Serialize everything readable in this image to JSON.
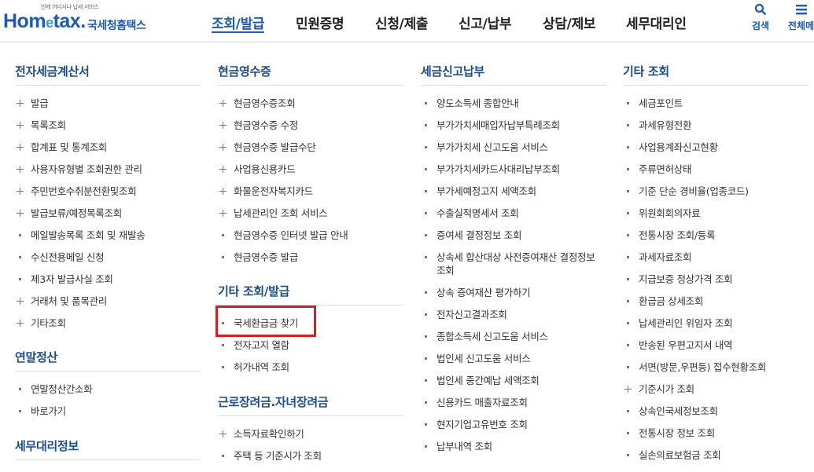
{
  "header": {
    "logo": {
      "tagline": "언제 어디서나 납세 서비스",
      "brand_a": "Hom",
      "brand_e": "e",
      "brand_b": "tax.",
      "agency": "국세청홈택스"
    },
    "nav": [
      "조회/발급",
      "민원증명",
      "신청/제출",
      "신고/납부",
      "상담/제보",
      "세무대리인"
    ],
    "active_nav": "조회/발급",
    "search_label": "검색",
    "menu_label": "전체메"
  },
  "colors": {
    "brand": "#1e5ab4",
    "section_title": "#1c4c8c",
    "highlight": "#d21f1f"
  },
  "columns": {
    "c1": {
      "s1": {
        "title": "전자세금계산서",
        "items": [
          {
            "label": "발급",
            "icon": "plus-icon"
          },
          {
            "label": "목록조회",
            "icon": "plus-icon"
          },
          {
            "label": "합계표 및 통계조회",
            "icon": "plus-icon"
          },
          {
            "label": "사용자유형별 조회권한 관리",
            "icon": "plus-icon"
          },
          {
            "label": "주민번호수취분전환및조회",
            "icon": "plus-icon"
          },
          {
            "label": "발급보류/예정목록조회",
            "icon": "plus-icon"
          },
          {
            "label": "메일발송목록 조회 및 재발송",
            "icon": "bullet-icon"
          },
          {
            "label": "수신전용메일 신청",
            "icon": "bullet-icon"
          },
          {
            "label": "제3자 발급사실 조회",
            "icon": "bullet-icon"
          },
          {
            "label": "거래처 및 품목관리",
            "icon": "plus-icon"
          },
          {
            "label": "기타조회",
            "icon": "plus-icon"
          }
        ]
      },
      "s2": {
        "title": "연말정산",
        "items": [
          {
            "label": "연말정산간소화",
            "icon": "bullet-icon"
          },
          {
            "label": "바로가기",
            "icon": "bullet-icon"
          }
        ]
      },
      "s3": {
        "title": "세무대리정보",
        "items": []
      }
    },
    "c2": {
      "s1": {
        "title": "현금영수증",
        "items": [
          {
            "label": "현금영수증조회",
            "icon": "plus-icon"
          },
          {
            "label": "현금영수증 수정",
            "icon": "plus-icon"
          },
          {
            "label": "현금영수증 발급수단",
            "icon": "plus-icon"
          },
          {
            "label": "사업용신용카드",
            "icon": "plus-icon"
          },
          {
            "label": "화물운전자복지카드",
            "icon": "plus-icon"
          },
          {
            "label": "납세관리인 조회 서비스",
            "icon": "plus-icon"
          },
          {
            "label": "현금영수증 인터넷 발급 안내",
            "icon": "bullet-icon"
          },
          {
            "label": "현금영수증 발급",
            "icon": "bullet-icon"
          }
        ]
      },
      "s2": {
        "title": "기타 조회/발급",
        "items": [
          {
            "label": "국세환급금 찾기",
            "icon": "bullet-icon"
          },
          {
            "label": "전자고지 열람",
            "icon": "bullet-icon"
          },
          {
            "label": "허가내역 조회",
            "icon": "bullet-icon"
          }
        ]
      },
      "s3": {
        "title": "근로장려금.자녀장려금",
        "items": [
          {
            "label": "소득자료확인하기",
            "icon": "plus-icon"
          },
          {
            "label": "주택 등 기준시가 조회",
            "icon": "bullet-icon"
          }
        ]
      }
    },
    "c3": {
      "s1": {
        "title": "세금신고납부",
        "items": [
          {
            "label": "양도소득세 종합안내",
            "icon": "bullet-icon"
          },
          {
            "label": "부가가치세매입자납부특례조회",
            "icon": "bullet-icon"
          },
          {
            "label": "부가가치세 신고도움 서비스",
            "icon": "bullet-icon"
          },
          {
            "label": "부가가치세카드사대리납부조회",
            "icon": "bullet-icon"
          },
          {
            "label": "부가세예정고지 세액조회",
            "icon": "bullet-icon"
          },
          {
            "label": "수출실적명세서 조회",
            "icon": "bullet-icon"
          },
          {
            "label": "증여세 결정정보 조회",
            "icon": "bullet-icon"
          },
          {
            "label": "상속세 합산대상 사전증여재산 결정정보 조회",
            "icon": "bullet-icon"
          },
          {
            "label": "상속 증여재산 평가하기",
            "icon": "bullet-icon"
          },
          {
            "label": "전자신고결과조회",
            "icon": "bullet-icon"
          },
          {
            "label": "종합소득세 신고도움 서비스",
            "icon": "bullet-icon"
          },
          {
            "label": "법인세 신고도움 서비스",
            "icon": "bullet-icon"
          },
          {
            "label": "법인세 중간예납 세액조회",
            "icon": "bullet-icon"
          },
          {
            "label": "신용카드 매출자료조회",
            "icon": "bullet-icon"
          },
          {
            "label": "현지기업고유번호 조회",
            "icon": "bullet-icon"
          },
          {
            "label": "납부내역 조회",
            "icon": "bullet-icon"
          }
        ]
      }
    },
    "c4": {
      "s1": {
        "title": "기타 조회",
        "items": [
          {
            "label": "세금포인트",
            "icon": "bullet-icon"
          },
          {
            "label": "과세유형전환",
            "icon": "bullet-icon"
          },
          {
            "label": "사업용계좌신고현황",
            "icon": "bullet-icon"
          },
          {
            "label": "주류면허상태",
            "icon": "bullet-icon"
          },
          {
            "label": "기준 단순 경비율(업종코드)",
            "icon": "bullet-icon"
          },
          {
            "label": "위원회회의자료",
            "icon": "bullet-icon"
          },
          {
            "label": "전통시장 조회/등록",
            "icon": "bullet-icon"
          },
          {
            "label": "과세자료조회",
            "icon": "bullet-icon"
          },
          {
            "label": "지급보증 정상가격 조회",
            "icon": "bullet-icon"
          },
          {
            "label": "환급금 상세조회",
            "icon": "bullet-icon"
          },
          {
            "label": "납세관리인 위임자 조회",
            "icon": "bullet-icon"
          },
          {
            "label": "반송된 우편고지서 내역",
            "icon": "bullet-icon"
          },
          {
            "label": "서면(방문,우편등) 접수현황조회",
            "icon": "bullet-icon"
          },
          {
            "label": "기준시가 조회",
            "icon": "plus-icon"
          },
          {
            "label": "상속인국세정보조회",
            "icon": "bullet-icon"
          },
          {
            "label": "전통시장 정보 조회",
            "icon": "bullet-icon"
          },
          {
            "label": "실손의료보험금 조회",
            "icon": "bullet-icon"
          }
        ]
      }
    }
  }
}
